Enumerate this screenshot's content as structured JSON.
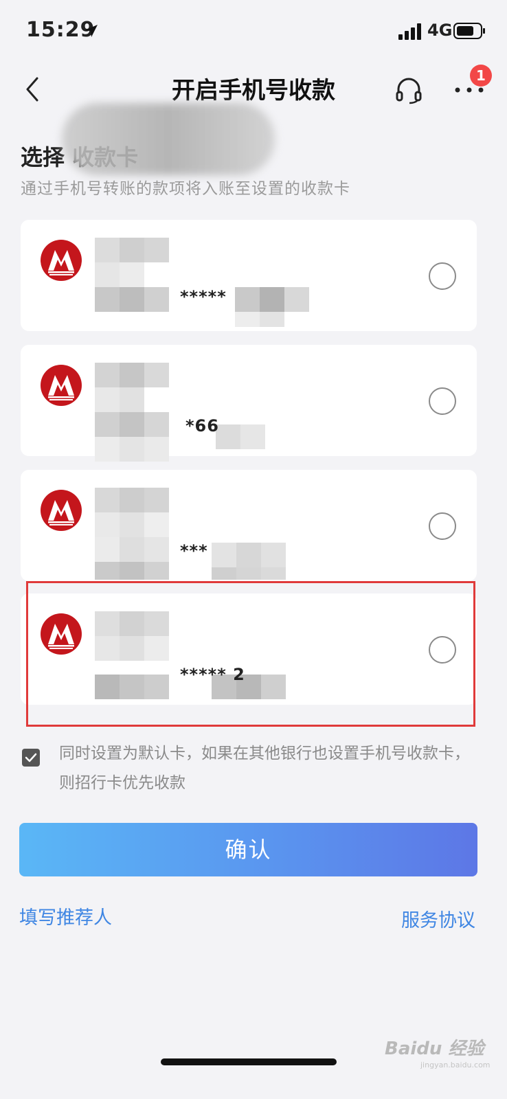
{
  "status_bar": {
    "time": "15:29",
    "network": "4G"
  },
  "nav": {
    "title": "开启手机号收款",
    "badge_count": "1"
  },
  "section": {
    "title": "选择 收款卡",
    "subtitle": "通过手机号转账的款项将入账至设置的收款卡"
  },
  "cards": [
    {
      "number_fragment": "*****",
      "selected": false
    },
    {
      "number_fragment": "*66",
      "selected": false
    },
    {
      "number_fragment": "***",
      "selected": false
    },
    {
      "number_fragment": "*****     2",
      "selected": false,
      "highlighted": true
    }
  ],
  "default_option": {
    "text": "同时设置为默认卡，如果在其他银行也设置手机号收款卡，则招行卡优先收款",
    "checked": true
  },
  "confirm_label": "确认",
  "links": {
    "referrer": "填写推荐人",
    "agreement": "服务协议"
  },
  "watermark": {
    "text": "Baidu 经验",
    "sub": "jingyan.baidu.com"
  },
  "colors": {
    "accent_blue": "#3f86e3",
    "button_gradient_start": "#5ab7f6",
    "button_gradient_end": "#5d77e6",
    "highlight_red": "#e03a3a",
    "bank_red": "#c4161c",
    "badge_red": "#f24747"
  },
  "icons": {
    "back": "chevron-left-icon",
    "service": "headset-icon",
    "more": "more-dots-icon",
    "bank": "cmb-bank-logo",
    "location": "location-arrow-icon",
    "signal": "signal-icon",
    "battery": "battery-icon"
  }
}
